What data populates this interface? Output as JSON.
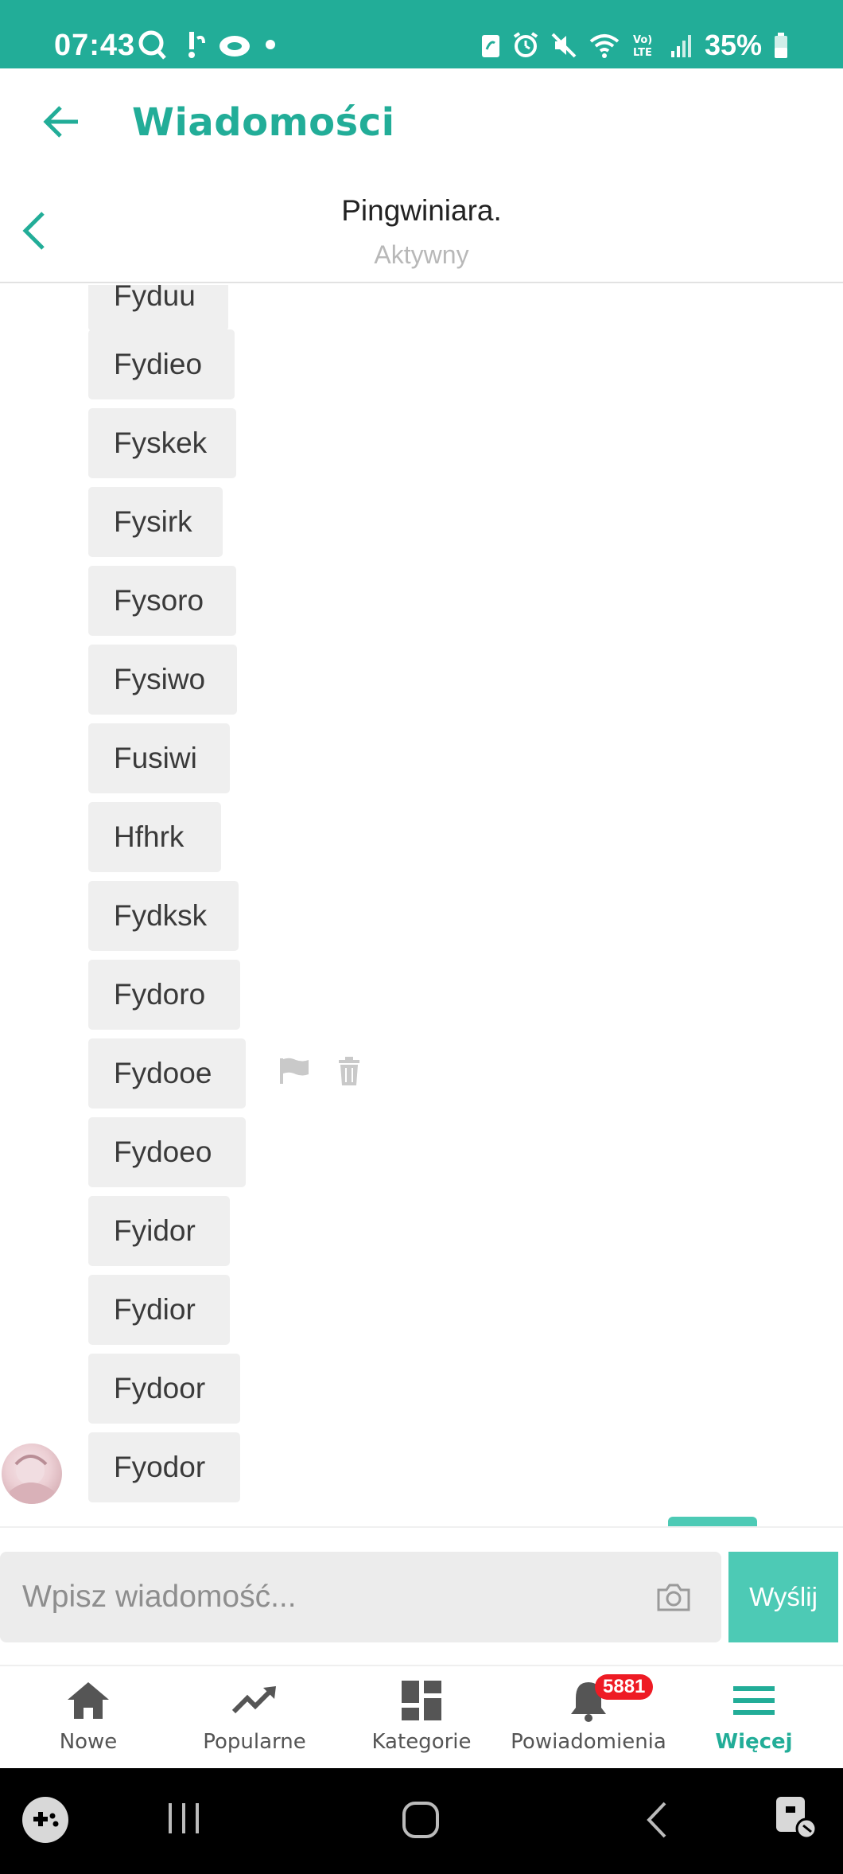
{
  "status_bar": {
    "time": "07:43",
    "battery": "35%",
    "icons_left": [
      "search-q-icon",
      "exclamation-bubble-icon",
      "cloud-icon",
      "dot-icon"
    ],
    "icons_right": [
      "battery-saver-icon",
      "alarm-icon",
      "mute-icon",
      "wifi-icon",
      "volte-icon",
      "signal-icon",
      "battery-icon"
    ]
  },
  "header": {
    "title": "Wiadomości"
  },
  "conversation": {
    "name": "Pingwiniara.",
    "status": "Aktywny"
  },
  "messages": [
    "Fyduu",
    "Fydieo",
    "Fyskek",
    "Fysirk",
    "Fysoro",
    "Fysiwo",
    "Fusiwi",
    "Hfhrk",
    "Fydksk",
    "Fydoro",
    "Fydooe",
    "Fydoeo",
    "Fyidor",
    "Fydior",
    "Fydoor",
    "Fyodor"
  ],
  "message_actions": [
    "flag-icon",
    "trash-icon"
  ],
  "composer": {
    "placeholder": "Wpisz wiadomość...",
    "send_label": "Wyślij"
  },
  "bottom_nav": [
    {
      "label": "Nowe",
      "icon": "home-icon"
    },
    {
      "label": "Popularne",
      "icon": "trending-icon"
    },
    {
      "label": "Kategorie",
      "icon": "dashboard-icon"
    },
    {
      "label": "Powiadomienia",
      "icon": "bell-icon",
      "badge": "5881"
    },
    {
      "label": "Więcej",
      "icon": "menu-icon",
      "active": true
    }
  ],
  "colors": {
    "accent": "#22ad98",
    "button": "#4dcab5",
    "badge": "#ee1b24",
    "bubble": "#efefef"
  }
}
